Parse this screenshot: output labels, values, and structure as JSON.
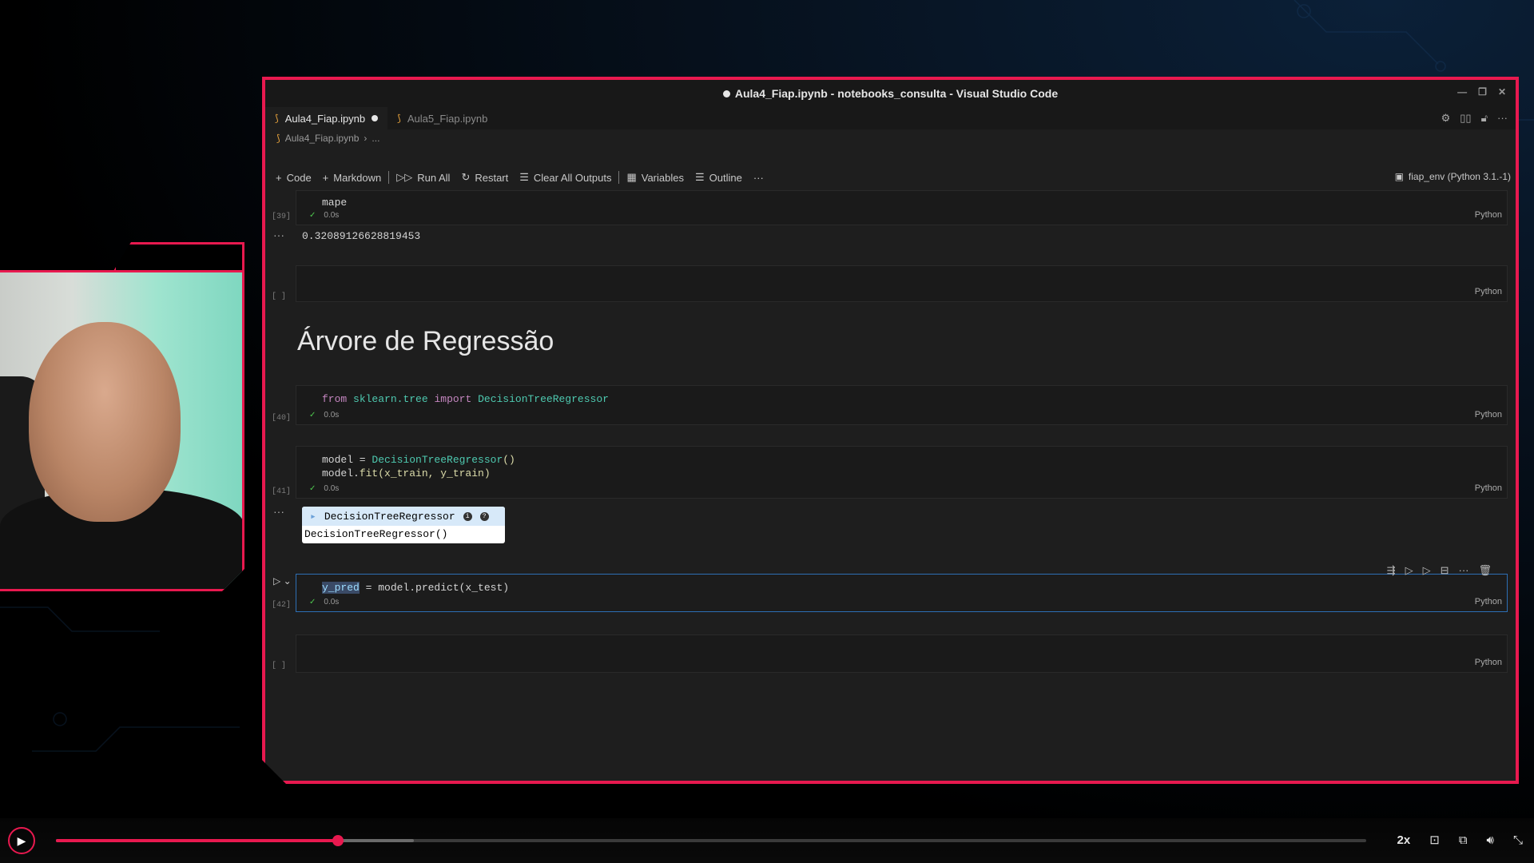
{
  "window": {
    "title": "Aula4_Fiap.ipynb - notebooks_consulta - Visual Studio Code"
  },
  "tabs": [
    {
      "label": "Aula4_Fiap.ipynb",
      "active": true,
      "modified": true
    },
    {
      "label": "Aula5_Fiap.ipynb",
      "active": false,
      "modified": false
    }
  ],
  "breadcrumb": {
    "file": "Aula4_Fiap.ipynb",
    "rest": "..."
  },
  "toolbar": {
    "code": "Code",
    "markdown": "Markdown",
    "run_all": "Run All",
    "restart": "Restart",
    "clear_outputs": "Clear All Outputs",
    "variables": "Variables",
    "outline": "Outline",
    "more": "···",
    "kernel": "fiap_env (Python 3.1.-1)"
  },
  "cells": {
    "c39": {
      "count": "[39]",
      "code": "mape",
      "time": "0.0s",
      "lang": "Python",
      "output": "0.32089126628819453"
    },
    "empty1": {
      "count": "[ ]",
      "lang": "Python"
    },
    "heading": "Árvore de Regressão",
    "c40": {
      "count": "[40]",
      "time": "0.0s",
      "lang": "Python",
      "tokens": {
        "from": "from",
        "module": "sklearn.tree",
        "import": "import",
        "cls": "DecisionTreeRegressor"
      }
    },
    "c41": {
      "count": "[41]",
      "time": "0.0s",
      "lang": "Python",
      "line1_a": "model = ",
      "line1_b": "DecisionTreeRegressor",
      "line1_c": "()",
      "line2_a": "model.",
      "line2_b": "fit",
      "line2_c": "(x_train, y_train)",
      "widget_title": "DecisionTreeRegressor",
      "widget_body": "DecisionTreeRegressor()"
    },
    "c42": {
      "count": "[42]",
      "time": "0.0s",
      "lang": "Python",
      "sel": "y_pred",
      "rest": " = model.predict(x_test)"
    },
    "empty2": {
      "count": "[ ]",
      "lang": "Python"
    }
  },
  "player": {
    "played_fraction": 0.215,
    "buffered_fraction": 0.273,
    "speed": "2x"
  },
  "colors": {
    "accent": "#e8194f",
    "focus": "#2d6fb5"
  }
}
